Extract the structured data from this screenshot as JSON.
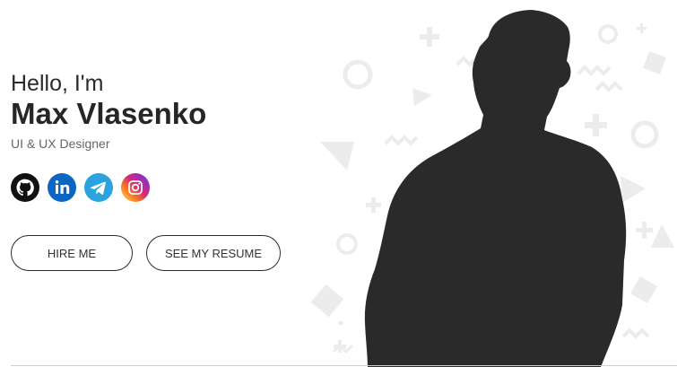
{
  "hero": {
    "greeting": "Hello, I'm",
    "name": "Max Vlasenko",
    "role": "UI & UX Designer"
  },
  "socials": [
    {
      "icon": "github-icon",
      "color": "#111111"
    },
    {
      "icon": "linkedin-icon",
      "color": "#0a66c2"
    },
    {
      "icon": "telegram-icon",
      "color": "#2aa3df"
    },
    {
      "icon": "instagram-icon",
      "color": "#d62976"
    }
  ],
  "buttons": {
    "hire": "HIRE ME",
    "resume": "SEE MY RESUME"
  },
  "colors": {
    "text": "#262626",
    "silhouette": "#2a2a2a",
    "shapes": "#ececec"
  }
}
